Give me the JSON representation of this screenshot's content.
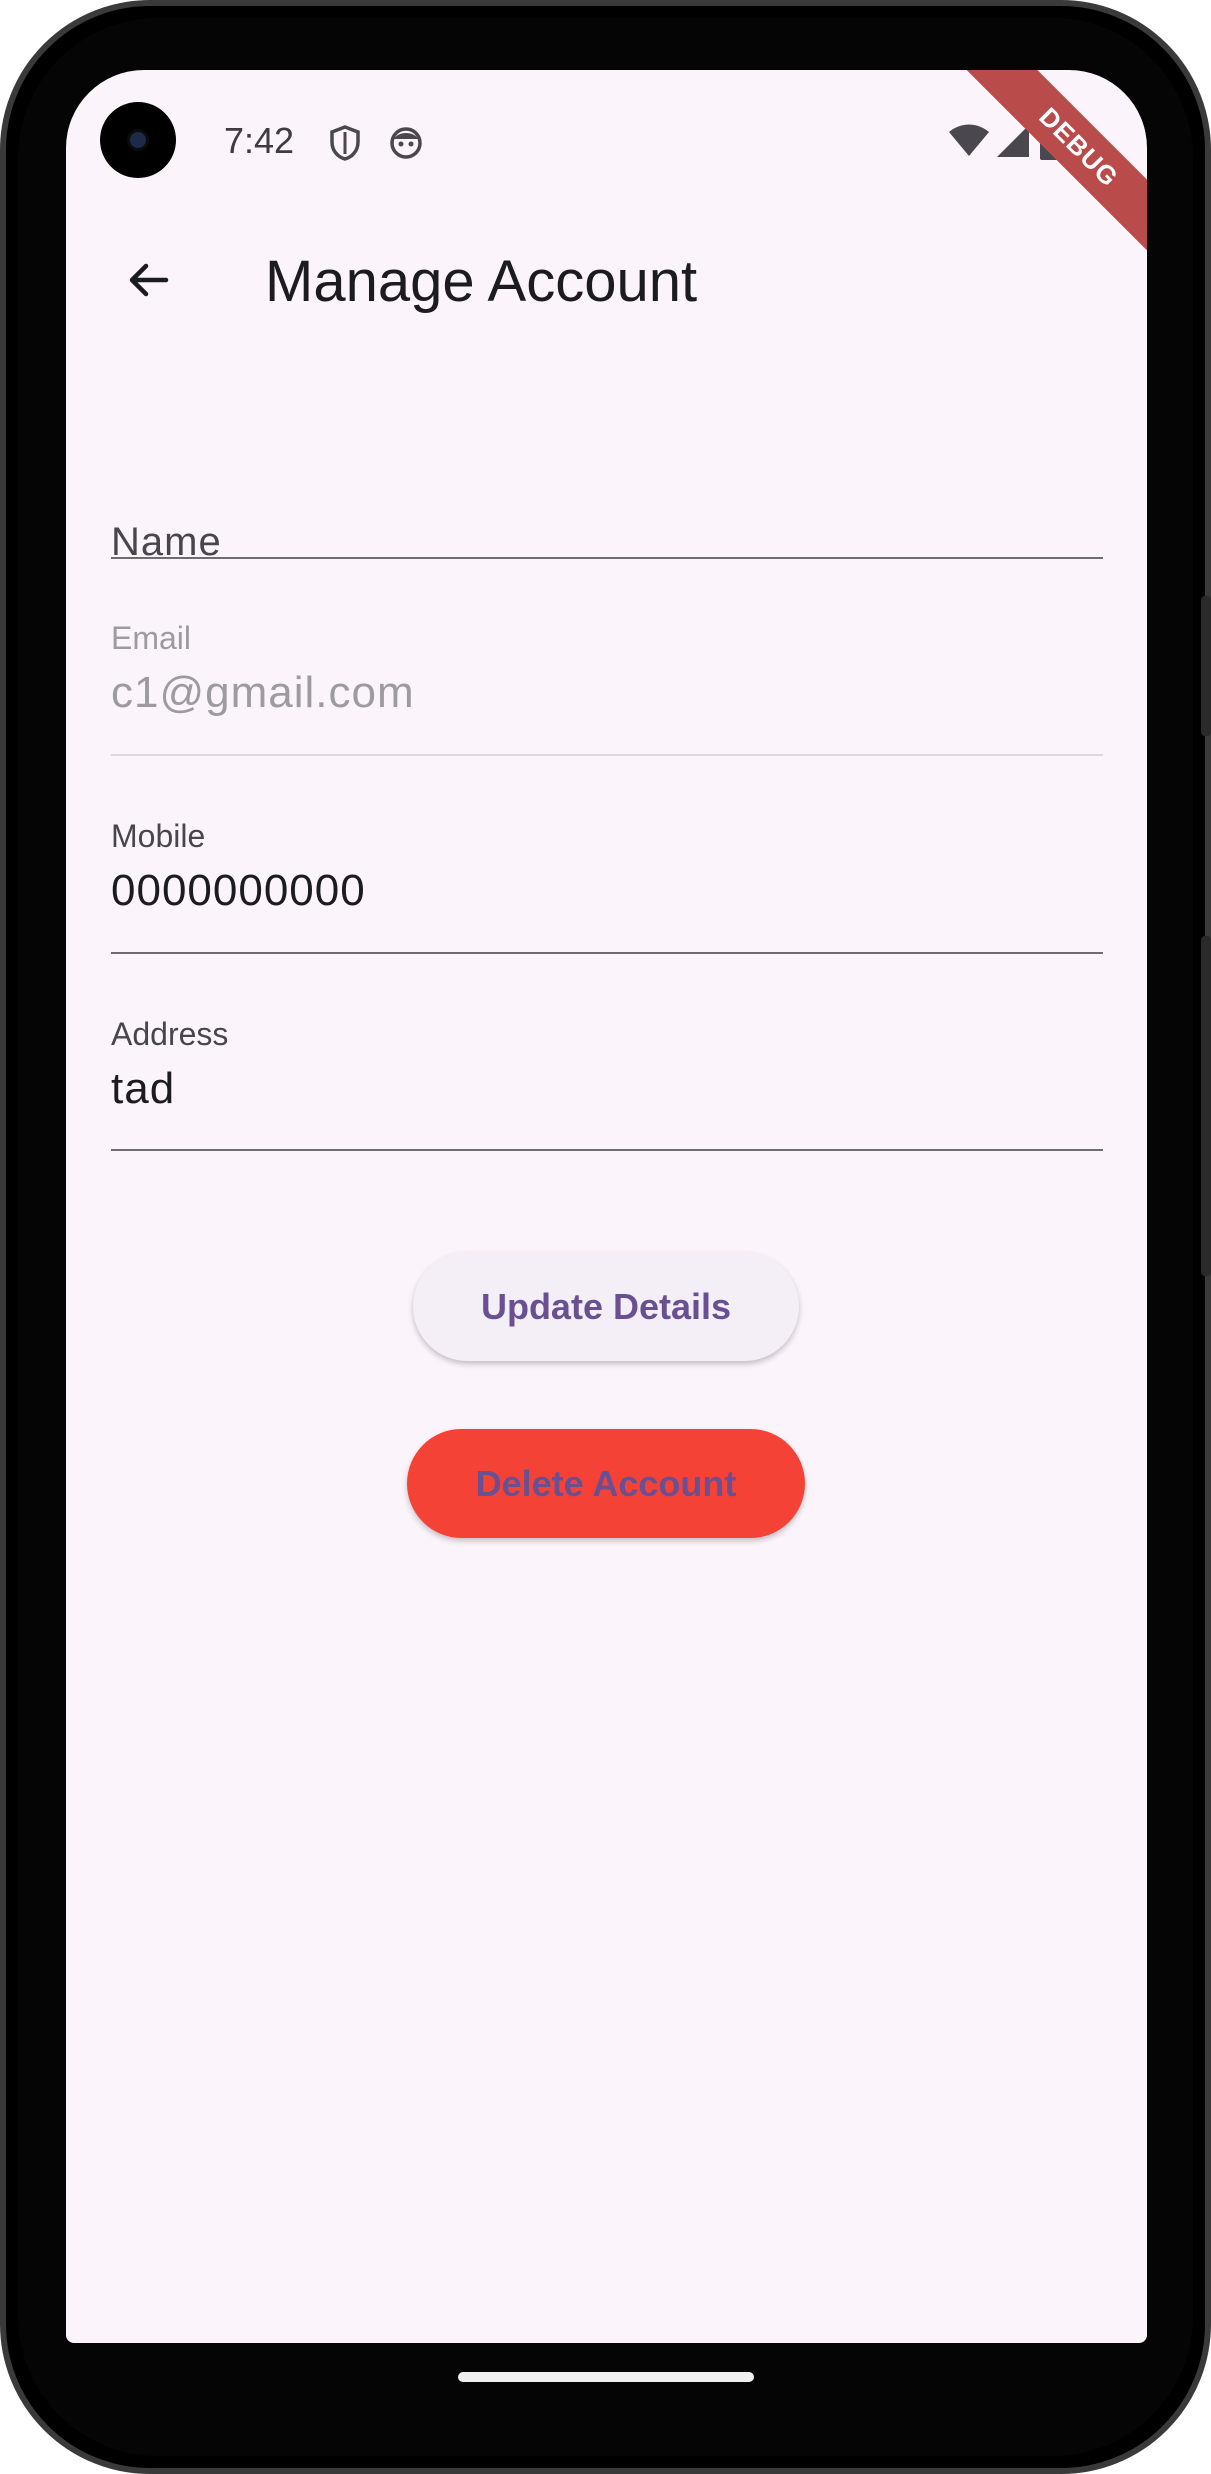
{
  "status_bar": {
    "time": "7:42",
    "left_icons": [
      "shield-icon",
      "face-icon"
    ],
    "right_icons": [
      "wifi-icon",
      "signal-icon",
      "battery-icon"
    ]
  },
  "debug_banner": "DEBUG",
  "app_bar": {
    "back_icon": "arrow-back-icon",
    "title": "Manage Account"
  },
  "form": {
    "name": {
      "label": "Name",
      "value": ""
    },
    "email": {
      "label": "Email",
      "value": "c1@gmail.com",
      "disabled": true
    },
    "mobile": {
      "label": "Mobile",
      "value": "0000000000"
    },
    "address": {
      "label": "Address",
      "value": "tad"
    }
  },
  "buttons": {
    "update_label": "Update Details",
    "delete_label": "Delete Account"
  },
  "colors": {
    "background": "#fcf4fb",
    "primary_text": "#6a4f92",
    "delete_button": "#f44336",
    "debug_banner": "#b94b4b"
  }
}
